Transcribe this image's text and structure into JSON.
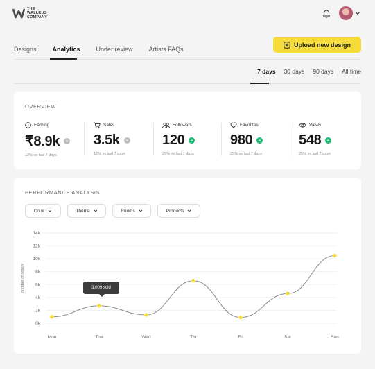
{
  "brand": {
    "line1": "THE",
    "line2": "WALLRUS",
    "line3": "COMPANY",
    "mark": "W-logo"
  },
  "header": {
    "notifications_icon": "bell-icon",
    "avatar_icon": "user-avatar",
    "menu_icon": "chevron-down-icon"
  },
  "nav": {
    "tabs": [
      {
        "label": "Designs",
        "active": false
      },
      {
        "label": "Analytics",
        "active": true
      },
      {
        "label": "Under review",
        "active": false
      },
      {
        "label": "Artists FAQs",
        "active": false
      }
    ],
    "upload_button": "Upload new design"
  },
  "ranges": [
    {
      "label": "7 days",
      "active": true
    },
    {
      "label": "30 days",
      "active": false
    },
    {
      "label": "90 days",
      "active": false
    },
    {
      "label": "All time",
      "active": false
    }
  ],
  "overview": {
    "title": "OVERVIEW",
    "stats": [
      {
        "icon": "clock-icon",
        "label": "Earning",
        "value": "₹8.9k",
        "trend": "neutral",
        "sub": "12% vs last 7 days"
      },
      {
        "icon": "cart-icon",
        "label": "Sales",
        "value": "3.5k",
        "trend": "neutral",
        "sub": "12% vs last 7 days"
      },
      {
        "icon": "followers-icon",
        "label": "Followers",
        "value": "120",
        "trend": "up",
        "sub": "25% vs last 7 days"
      },
      {
        "icon": "heart-icon",
        "label": "Favorites",
        "value": "980",
        "trend": "up",
        "sub": "25% vs last 7 days"
      },
      {
        "icon": "eye-icon",
        "label": "Views",
        "value": "548",
        "trend": "up",
        "sub": "25% vs last 7 days"
      }
    ]
  },
  "performance": {
    "title": "PERFORMANCE ANALYSIS",
    "filters": [
      "Color",
      "Theme",
      "Rooms",
      "Products"
    ],
    "tooltip": "3,009 sold"
  },
  "colors": {
    "accent": "#f5dc3b",
    "up": "#1fb871",
    "neutral": "#bdbdbd",
    "line": "#8a8a8a",
    "point": "#f5dc3b"
  },
  "chart_data": {
    "type": "line",
    "title": "",
    "xlabel": "",
    "ylabel": "number of orders",
    "categories": [
      "Mon",
      "Tue",
      "Wed",
      "Thr",
      "Fri",
      "Sat",
      "Sun"
    ],
    "series": [
      {
        "values": [
          1000,
          2700,
          1300,
          6600,
          900,
          4600,
          10500
        ]
      }
    ],
    "yticks": [
      "0k",
      "2k",
      "4k",
      "6k",
      "8k",
      "10k",
      "12k",
      "14k"
    ],
    "ylim": [
      0,
      14000
    ],
    "grid": true,
    "legend": "none"
  }
}
